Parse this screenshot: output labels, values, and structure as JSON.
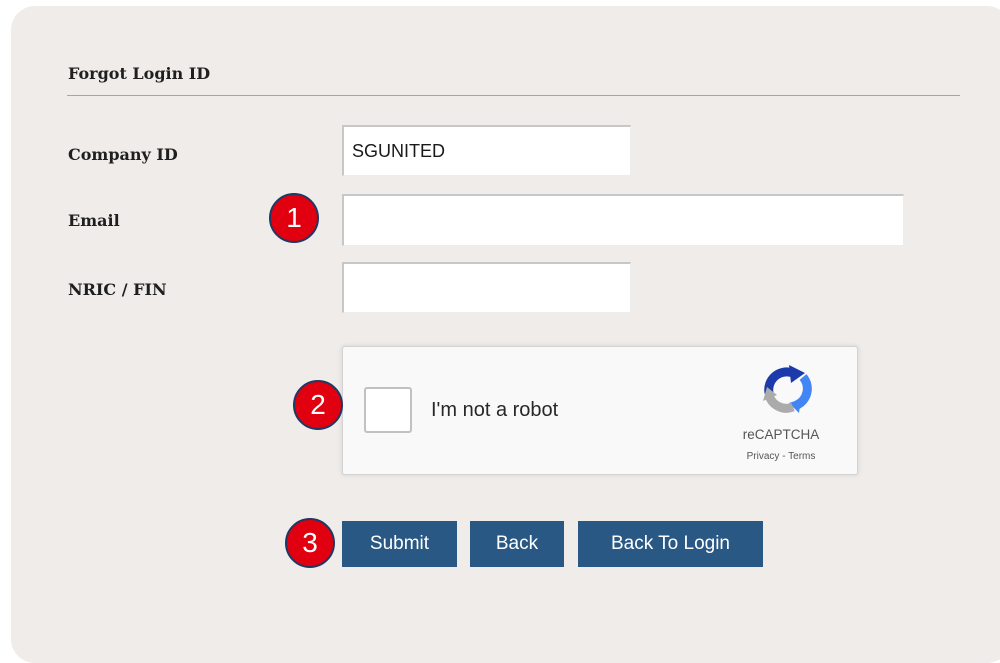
{
  "form": {
    "title": "Forgot Login ID",
    "company_id": {
      "label": "Company ID",
      "value": "SGUNITED"
    },
    "email": {
      "label": "Email",
      "value": ""
    },
    "nric": {
      "label": "NRIC / FIN",
      "value": ""
    }
  },
  "captcha": {
    "checkbox_label": "I'm not a robot",
    "brand": "reCAPTCHA",
    "privacy": "Privacy",
    "separator": " - ",
    "terms": "Terms"
  },
  "buttons": {
    "submit": "Submit",
    "back": "Back",
    "back_to_login": "Back To Login"
  },
  "annotations": {
    "step1": "1",
    "step2": "2",
    "step3": "3"
  },
  "colors": {
    "panel_bg": "#efecea",
    "button_bg": "#285883",
    "badge_fill": "#e0000f",
    "badge_border": "#1f3864"
  }
}
